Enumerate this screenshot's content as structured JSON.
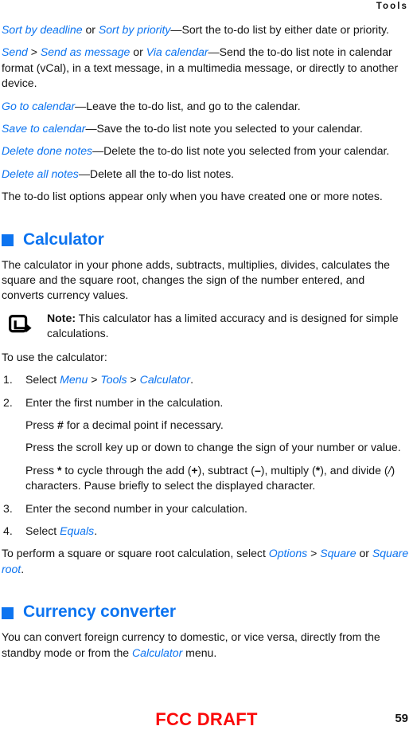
{
  "header": {
    "running_title": "Tools"
  },
  "colors": {
    "accent_blue": "#0d74f0",
    "draft_red": "#fa0a0a",
    "body_text": "#141414"
  },
  "options_list": {
    "items": [
      {
        "term_a": "Sort by deadline",
        "connector": " or ",
        "term_b": "Sort by priority",
        "description": "—Sort the to-do list by either date or priority."
      },
      {
        "term_a": "Send",
        "connector_gt": " > ",
        "term_b": "Send as message",
        "connector": " or ",
        "term_c": "Via calendar",
        "description": "—Send the to-do list note in calendar format (vCal), in a text message, in a multimedia message, or directly to another device."
      },
      {
        "term_a": "Go to calendar",
        "description": "—Leave the to-do list, and go to the calendar."
      },
      {
        "term_a": "Save to calendar",
        "description": "—Save the to-do list note you selected to your calendar."
      },
      {
        "term_a": "Delete done notes",
        "description": "—Delete the to-do list note you selected from your calendar."
      },
      {
        "term_a": "Delete all notes",
        "description": "—Delete all the to-do list notes."
      }
    ],
    "closing_paragraph": "The to-do list options appear only when you have created one or more notes."
  },
  "calculator_section": {
    "heading": "Calculator",
    "bullet_icon": "square-bullet-icon",
    "intro": "The calculator in your phone adds, subtracts, multiplies, divides, calculates the square and the square root, changes the sign of the number entered, and converts currency values.",
    "note": {
      "icon": "note-arrow-icon",
      "label": "Note:",
      "text": " This calculator has a limited accuracy and is designed for simple calculations."
    },
    "lead_in": "To use the calculator:",
    "steps": [
      {
        "number": "1.",
        "text_before": "Select ",
        "link_1": "Menu",
        "sep_1": " > ",
        "link_2": "Tools",
        "sep_2": " > ",
        "link_3": "Calculator",
        "text_after": "."
      },
      {
        "number": "2.",
        "text_before": "Enter the first number in the calculation.",
        "substeps": [
          {
            "part_1": "Press ",
            "bold_1": "#",
            "part_2": " for a decimal point if necessary."
          },
          {
            "part_1": "Press the scroll key up or down to change the sign of your number or value.",
            "bold_1": "",
            "part_2": ""
          },
          {
            "part_1": "Press ",
            "bold_1": "*",
            "part_2": " to cycle through the add (",
            "bold_2": "+",
            "part_3": "), subtract (",
            "bold_3": "–",
            "part_4": "), multiply (",
            "bold_4": "*",
            "part_5": "), and divide (",
            "italic_5": "/",
            "part_6": ") characters. Pause briefly to select the displayed character."
          }
        ]
      },
      {
        "number": "3.",
        "text_before": "Enter the second number in your calculation."
      },
      {
        "number": "4.",
        "text_before": "Select ",
        "link_1": "Equals",
        "text_after": "."
      }
    ],
    "closing": {
      "part_1": "To perform a square or square root calculation, select ",
      "link_1": "Options",
      "sep_1": " > ",
      "link_2": "Square",
      "part_2": " or ",
      "link_3": "Square root",
      "part_3": "."
    }
  },
  "currency_section": {
    "heading": "Currency converter",
    "bullet_icon": "square-bullet-icon",
    "paragraph": {
      "part_1": "You can convert foreign currency to domestic, or vice versa, directly from the standby mode or from the ",
      "link_1": "Calculator",
      "part_2": " menu."
    }
  },
  "footer": {
    "draft_stamp": "FCC DRAFT",
    "page_number": "59"
  }
}
